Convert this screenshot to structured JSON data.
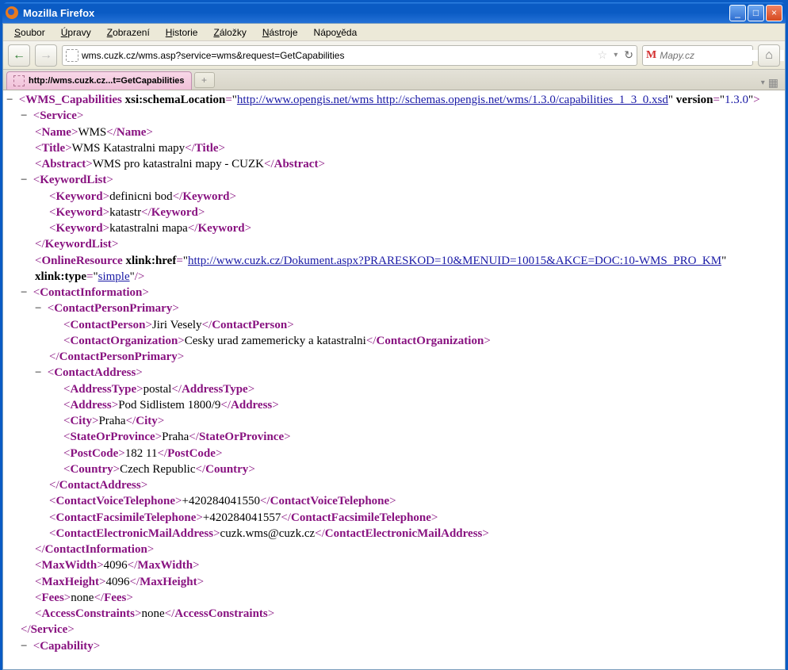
{
  "window": {
    "title": "Mozilla Firefox"
  },
  "menu": {
    "items": [
      {
        "label": "Soubor",
        "u": 0
      },
      {
        "label": "Úpravy",
        "u": 0
      },
      {
        "label": "Zobrazení",
        "u": 0
      },
      {
        "label": "Historie",
        "u": 0
      },
      {
        "label": "Záložky",
        "u": 0
      },
      {
        "label": "Nástroje",
        "u": 0
      },
      {
        "label": "Nápověda",
        "u": 4
      }
    ]
  },
  "toolbar": {
    "url": "wms.cuzk.cz/wms.asp?service=wms&request=GetCapabilities",
    "search_placeholder": "Mapy.cz"
  },
  "tab": {
    "label": "http://wms.cuzk.cz...t=GetCapabilities"
  },
  "xml": {
    "root": "WMS_Capabilities",
    "schemaLocAttr": "xsi:schemaLocation",
    "schemaLoc": "http://www.opengis.net/wms http://schemas.opengis.net/wms/1.3.0/capabilities_1_3_0.xsd",
    "versionAttr": "version",
    "version": "1.3.0",
    "service": {
      "tag": "Service",
      "name": {
        "tag": "Name",
        "text": "WMS"
      },
      "title": {
        "tag": "Title",
        "text": "WMS Katastralni mapy"
      },
      "abstract": {
        "tag": "Abstract",
        "text": "WMS pro katastralni mapy - CUZK"
      },
      "keywordList": {
        "tag": "KeywordList",
        "items": [
          {
            "tag": "Keyword",
            "text": "definicni bod"
          },
          {
            "tag": "Keyword",
            "text": "katastr"
          },
          {
            "tag": "Keyword",
            "text": "katastralni mapa"
          }
        ]
      },
      "onlineResource": {
        "tag": "OnlineResource",
        "hrefAttr": "xlink:href",
        "href": "http://www.cuzk.cz/Dokument.aspx?PRARESKOD=10&MENUID=10015&AKCE=DOC:10-WMS_PRO_KM",
        "typeAttr": "xlink:type",
        "type": "simple"
      },
      "contactInfo": {
        "tag": "ContactInformation",
        "personPrimary": {
          "tag": "ContactPersonPrimary",
          "person": {
            "tag": "ContactPerson",
            "text": "Jiri Vesely"
          },
          "org": {
            "tag": "ContactOrganization",
            "text": "Cesky urad zamemericky a katastralni"
          }
        },
        "address": {
          "tag": "ContactAddress",
          "type": {
            "tag": "AddressType",
            "text": "postal"
          },
          "addr": {
            "tag": "Address",
            "text": "Pod Sidlistem 1800/9"
          },
          "city": {
            "tag": "City",
            "text": "Praha"
          },
          "state": {
            "tag": "StateOrProvince",
            "text": "Praha"
          },
          "post": {
            "tag": "PostCode",
            "text": "182 11"
          },
          "country": {
            "tag": "Country",
            "text": "Czech Republic"
          }
        },
        "voice": {
          "tag": "ContactVoiceTelephone",
          "text": "+420284041550"
        },
        "fax": {
          "tag": "ContactFacsimileTelephone",
          "text": "+420284041557"
        },
        "email": {
          "tag": "ContactElectronicMailAddress",
          "text": "cuzk.wms@cuzk.cz"
        }
      },
      "maxWidth": {
        "tag": "MaxWidth",
        "text": "4096"
      },
      "maxHeight": {
        "tag": "MaxHeight",
        "text": "4096"
      },
      "fees": {
        "tag": "Fees",
        "text": "none"
      },
      "access": {
        "tag": "AccessConstraints",
        "text": "none"
      }
    },
    "capability": {
      "tag": "Capability"
    }
  }
}
